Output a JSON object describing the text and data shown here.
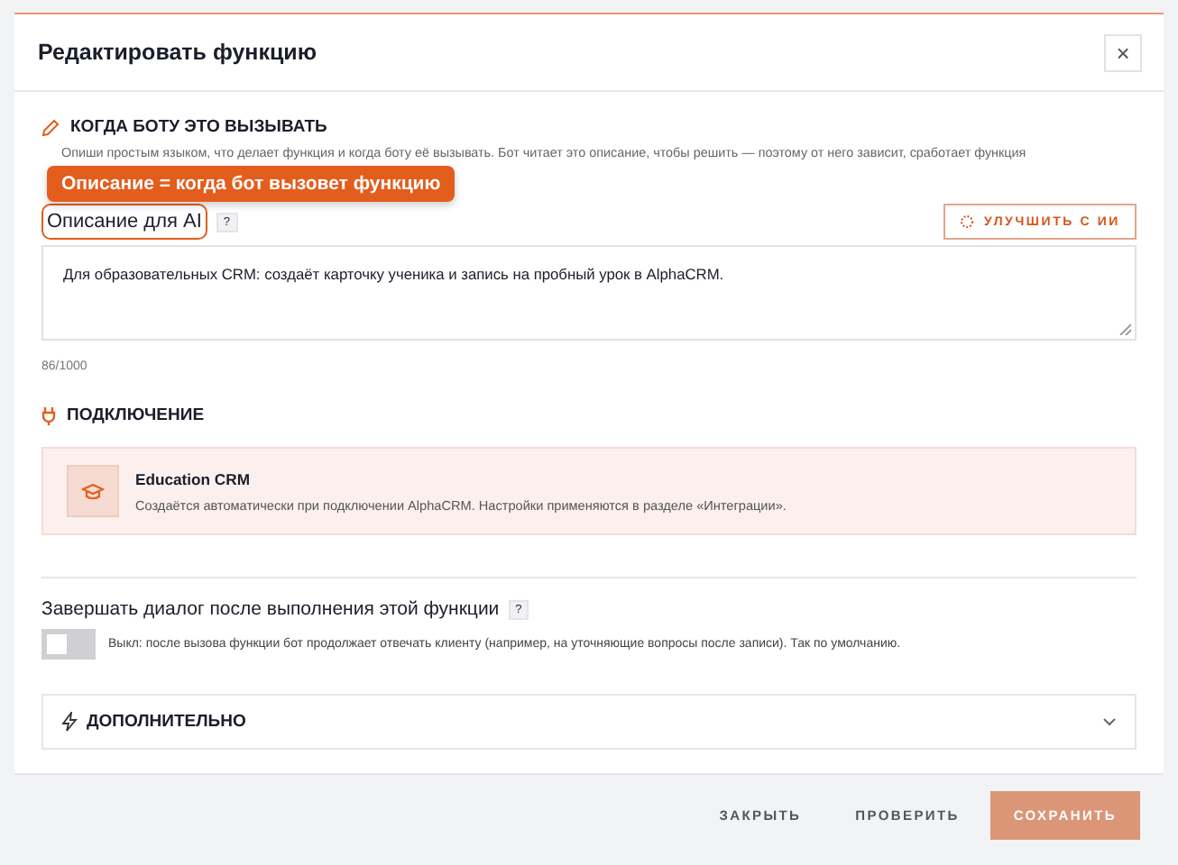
{
  "dialog": {
    "title": "Редактировать функцию",
    "close": "×"
  },
  "when_section": {
    "title": "КОГДА БОТУ ЭТО ВЫЗЫВАТЬ",
    "hint": "Опиши простым языком, что делает функция и когда боту её вызывать. Бот читает это описание, чтобы решить — поэтому от него зависит, сработает функция"
  },
  "callout": "Описание = когда бот вызовет функцию",
  "description_field": {
    "label": "Описание для AI",
    "help": "?",
    "improve_button": "УЛУЧШИТЬ С ИИ",
    "value": "Для образовательных CRM: создаёт карточку ученика и запись на пробный урок в AlphaCRM.",
    "counter": "86/1000"
  },
  "connection_section": {
    "title": "ПОДКЛЮЧЕНИЕ",
    "card_title": "Education CRM",
    "card_text": "Создаётся автоматически при подключении AlphaCRM. Настройки применяются в разделе «Интеграции»."
  },
  "end_dialog": {
    "label": "Завершать диалог после выполнения этой функции",
    "help": "?",
    "on": false,
    "hint": "Выкл: после вызова функции бот продолжает отвечать клиенту (например, на уточняющие вопросы после записи). Так по умолчанию."
  },
  "advanced": {
    "title": "ДОПОЛНИТЕЛЬНО",
    "expanded": false
  },
  "buttons": [
    {
      "label": "ЗАКРЫТЬ",
      "kind": "text"
    },
    {
      "label": "ПРОВЕРИТЬ",
      "kind": "text"
    },
    {
      "label": "СОХРАНИТЬ",
      "kind": "primary"
    }
  ]
}
